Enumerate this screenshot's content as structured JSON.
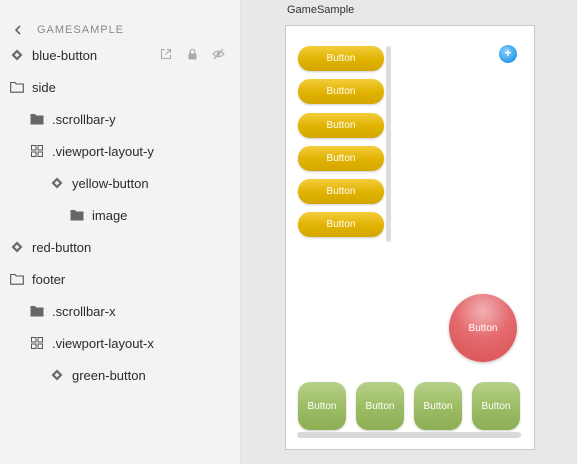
{
  "panel": {
    "title": "GAMESAMPLE",
    "items": [
      {
        "label": "blue-button"
      },
      {
        "label": "side"
      },
      {
        "label": ".scrollbar-y"
      },
      {
        "label": ".viewport-layout-y"
      },
      {
        "label": "yellow-button"
      },
      {
        "label": "image"
      },
      {
        "label": "red-button"
      },
      {
        "label": "footer"
      },
      {
        "label": ".scrollbar-x"
      },
      {
        "label": ".viewport-layout-x"
      },
      {
        "label": "green-button"
      }
    ],
    "row_actions": [
      "open-external-icon",
      "lock-icon",
      "eye-hidden-icon"
    ]
  },
  "canvas": {
    "title": "GameSample",
    "blue_button": "+",
    "yellow_buttons": [
      "Button",
      "Button",
      "Button",
      "Button",
      "Button",
      "Button"
    ],
    "red_button": "Button",
    "green_buttons": [
      "Button",
      "Button",
      "Button",
      "Button"
    ]
  },
  "colors": {
    "yellow": "#e0b200",
    "blue": "#3aa2ee",
    "red": "#e46a6e",
    "green": "#9dbd66",
    "panel_bg": "#f3f3f3",
    "canvas_bg": "#e8e8e8"
  }
}
